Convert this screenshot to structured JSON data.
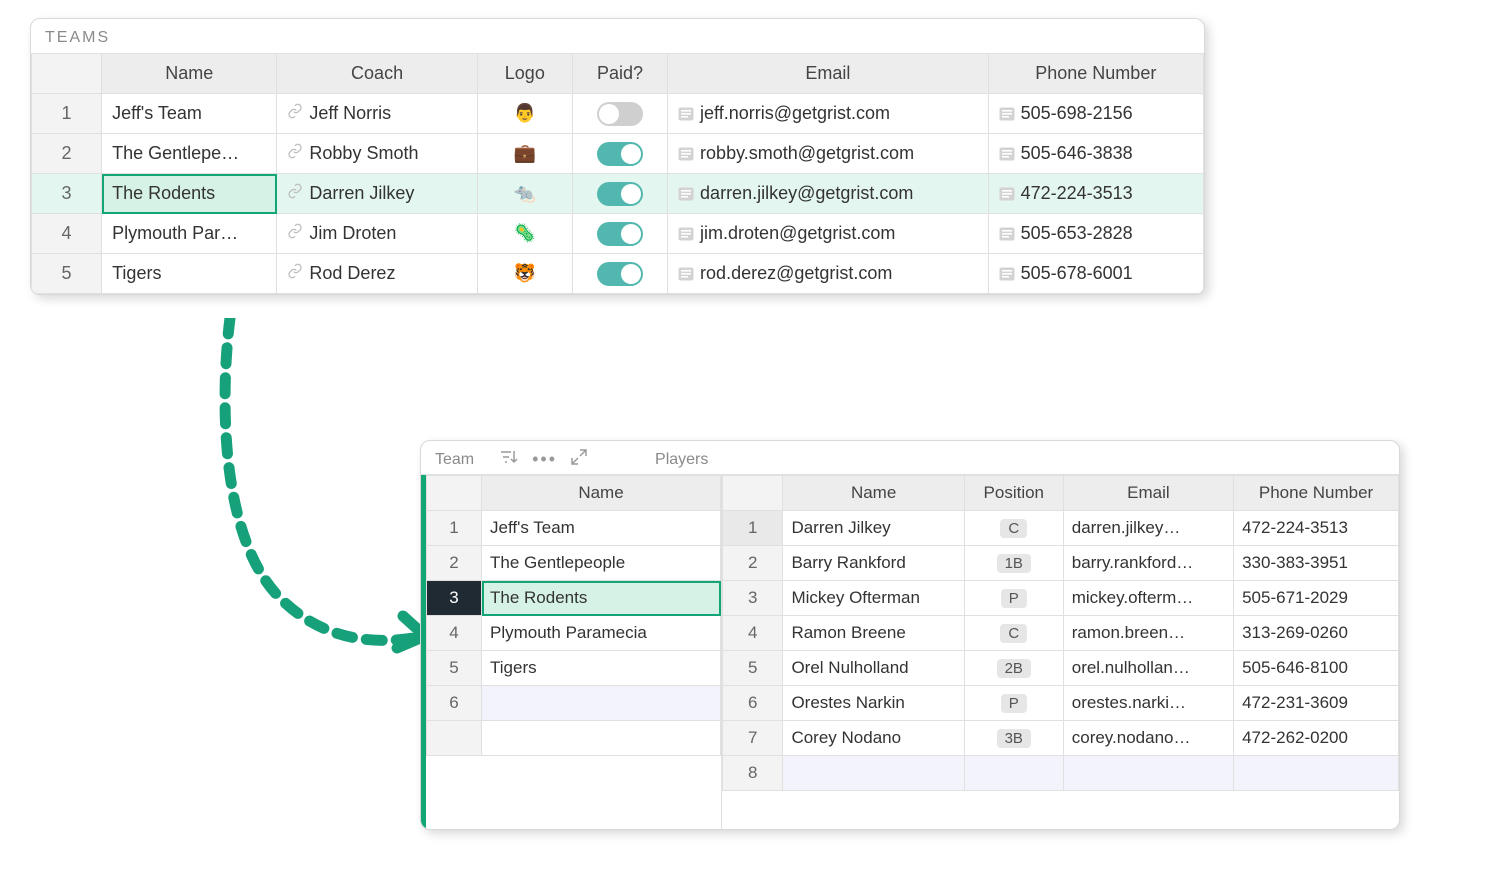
{
  "top": {
    "title": "TEAMS",
    "columns": [
      "Name",
      "Coach",
      "Logo",
      "Paid?",
      "Email",
      "Phone Number"
    ],
    "rows": [
      {
        "n": "1",
        "name": "Jeff's Team",
        "coach": "Jeff Norris",
        "logo": "👨",
        "paid": false,
        "email": "jeff.norris@getgrist.com",
        "phone": "505-698-2156"
      },
      {
        "n": "2",
        "name": "The Gentlepe…",
        "coach": "Robby Smoth",
        "logo": "💼",
        "paid": true,
        "email": "robby.smoth@getgrist.com",
        "phone": "505-646-3838"
      },
      {
        "n": "3",
        "name": "The Rodents",
        "coach": "Darren Jilkey",
        "logo": "🐀",
        "paid": true,
        "email": "darren.jilkey@getgrist.com",
        "phone": "472-224-3513",
        "selected": true
      },
      {
        "n": "4",
        "name": "Plymouth Par…",
        "coach": "Jim Droten",
        "logo": "🦠",
        "paid": true,
        "email": "jim.droten@getgrist.com",
        "phone": "505-653-2828"
      },
      {
        "n": "5",
        "name": "Tigers",
        "coach": "Rod Derez",
        "logo": "🐯",
        "paid": true,
        "email": "rod.derez@getgrist.com",
        "phone": "505-678-6001"
      }
    ]
  },
  "linked": {
    "team_label": "Team",
    "players_label": "Players",
    "team_col": "Name",
    "teams": [
      {
        "n": "1",
        "name": "Jeff's Team"
      },
      {
        "n": "2",
        "name": "The Gentlepeople"
      },
      {
        "n": "3",
        "name": "The Rodents",
        "selected": true
      },
      {
        "n": "4",
        "name": "Plymouth Paramecia"
      },
      {
        "n": "5",
        "name": "Tigers"
      },
      {
        "n": "6",
        "name": ""
      }
    ],
    "player_cols": [
      "Name",
      "Position",
      "Email",
      "Phone Number"
    ],
    "players": [
      {
        "n": "1",
        "name": "Darren Jilkey",
        "pos": "C",
        "email": "darren.jilkey…",
        "phone": "472-224-3513",
        "selected": true
      },
      {
        "n": "2",
        "name": "Barry Rankford",
        "pos": "1B",
        "email": "barry.rankford…",
        "phone": "330-383-3951"
      },
      {
        "n": "3",
        "name": "Mickey Ofterman",
        "pos": "P",
        "email": "mickey.ofterm…",
        "phone": "505-671-2029"
      },
      {
        "n": "4",
        "name": "Ramon Breene",
        "pos": "C",
        "email": "ramon.breen…",
        "phone": "313-269-0260"
      },
      {
        "n": "5",
        "name": "Orel Nulholland",
        "pos": "2B",
        "email": "orel.nulhollan…",
        "phone": "505-646-8100"
      },
      {
        "n": "6",
        "name": "Orestes Narkin",
        "pos": "P",
        "email": "orestes.narki…",
        "phone": "472-231-3609"
      },
      {
        "n": "7",
        "name": "Corey Nodano",
        "pos": "3B",
        "email": "corey.nodano…",
        "phone": "472-262-0200"
      },
      {
        "n": "8",
        "name": "",
        "pos": "",
        "email": "",
        "phone": "",
        "empty": true
      }
    ]
  }
}
